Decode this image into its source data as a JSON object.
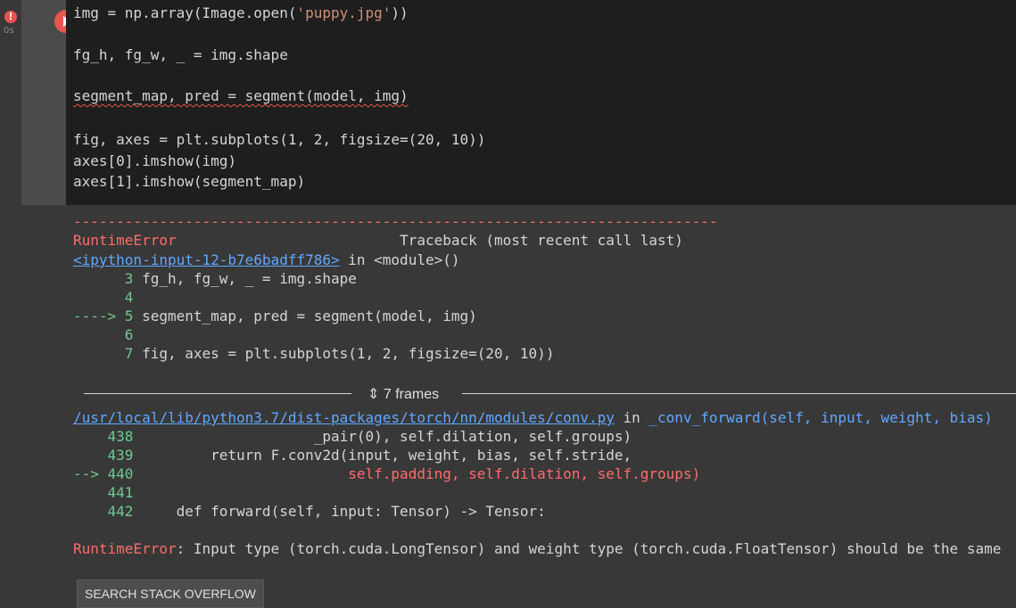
{
  "cell": {
    "status": "!",
    "exec_time": "0s",
    "code": [
      {
        "t": "img = np.array(Image.open(",
        "s": "'puppy.jpg'",
        "e": "))"
      },
      {
        "t": ""
      },
      {
        "t": "fg_h, fg_w, _ = img.shape"
      },
      {
        "t": ""
      },
      {
        "t": "segment_map, pred = segment(model, img)"
      },
      {
        "t": ""
      },
      {
        "t": "fig, axes = plt.subplots(1, 2, figsize=(20, 10))"
      },
      {
        "t": "axes[0].imshow(img)"
      },
      {
        "t": "axes[1].imshow(segment_map)"
      }
    ]
  },
  "output": {
    "dashes": "---------------------------------------------------------------------------",
    "error_name": "RuntimeError",
    "traceback_label": "Traceback (most recent call last)",
    "input_link": "<ipython-input-12-b7e6badff786>",
    "in_module": " in <module>()",
    "frame1": [
      {
        "arrow": "      ",
        "num": "3",
        "code": " fg_h, fg_w, _ = img.shape"
      },
      {
        "arrow": "      ",
        "num": "4",
        "code": ""
      },
      {
        "arrow": "----> ",
        "num": "5",
        "code": " segment_map, pred = segment(model, img)"
      },
      {
        "arrow": "      ",
        "num": "6",
        "code": ""
      },
      {
        "arrow": "      ",
        "num": "7",
        "code": " fig, axes = plt.subplots(1, 2, figsize=(20, 10))"
      }
    ],
    "frames_label": "7 frames",
    "conv_link": "/usr/local/lib/python3.7/dist-packages/torch/nn/modules/conv.py",
    "conv_in": " in ",
    "conv_func": "_conv_forward(self, input, weight, bias)",
    "frame2": [
      {
        "arrow": "    ",
        "num": "438",
        "code": "                     _pair(0), self.dilation, self.groups)"
      },
      {
        "arrow": "    ",
        "num": "439",
        "code": "         return F.conv2d(input, weight, bias, self.stride,"
      },
      {
        "arrow": "--> ",
        "num": "440",
        "code": "                         self.padding, self.dilation, self.groups)"
      },
      {
        "arrow": "    ",
        "num": "441",
        "code": ""
      },
      {
        "arrow": "    ",
        "num": "442",
        "code": "     def forward(self, input: Tensor) -> Tensor:"
      }
    ],
    "final_error_name": "RuntimeError",
    "final_error_msg": ": Input type (torch.cuda.LongTensor) and weight type (torch.cuda.FloatTensor) should be the same",
    "so_button": "SEARCH STACK OVERFLOW"
  }
}
